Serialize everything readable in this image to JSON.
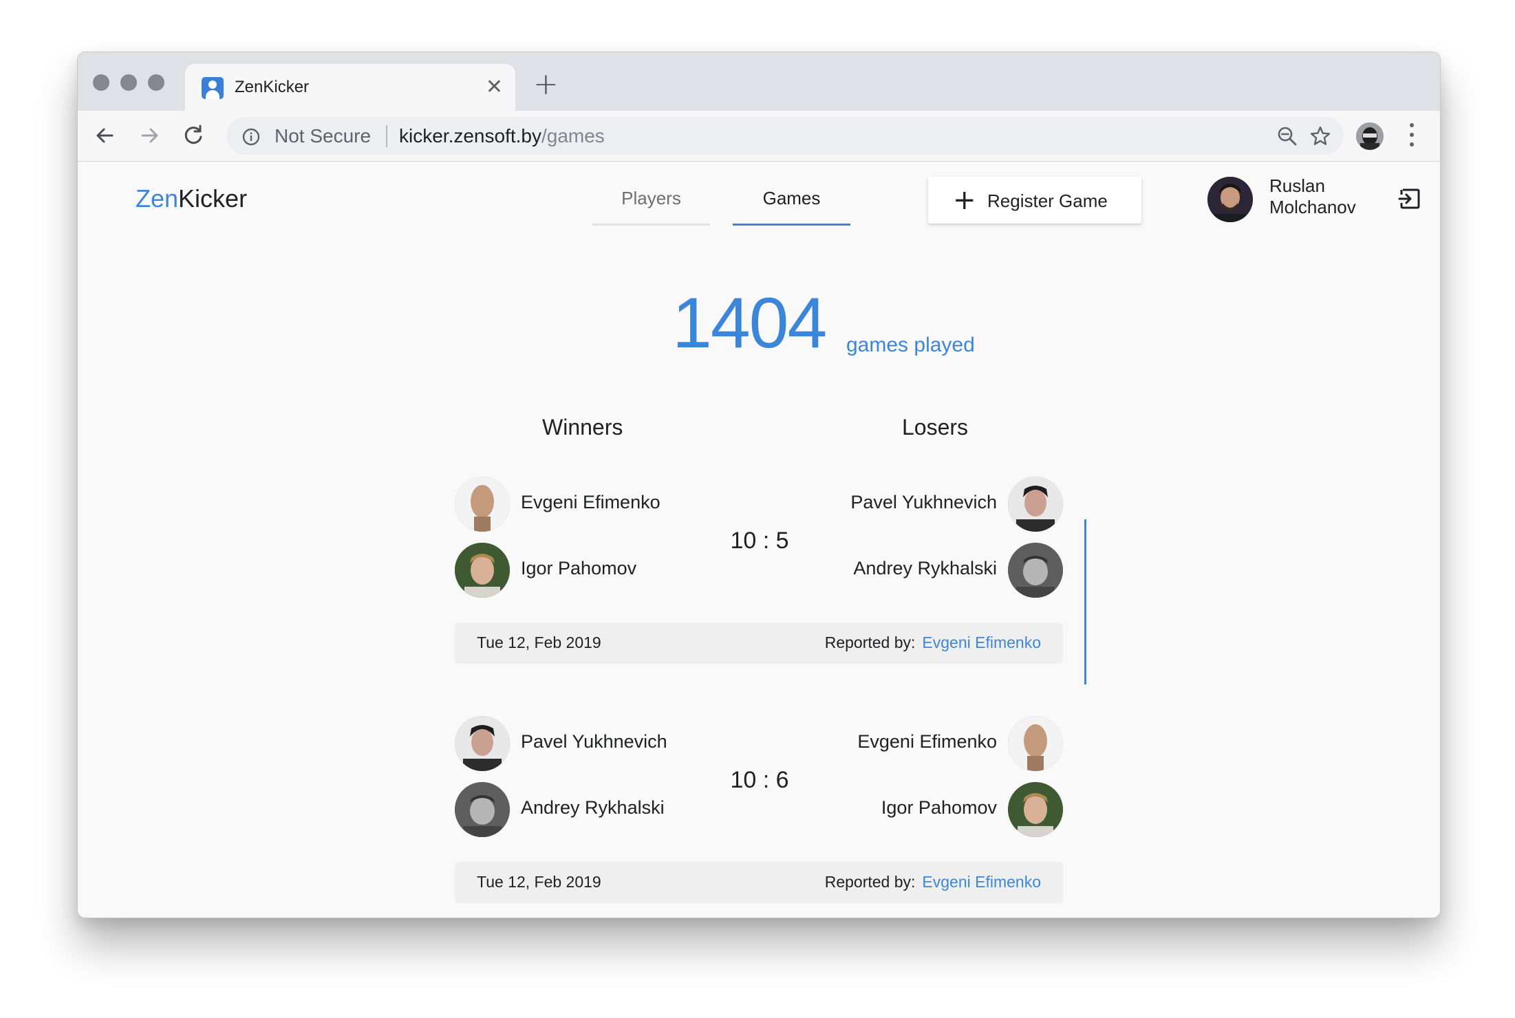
{
  "browser": {
    "tab_title": "ZenKicker",
    "url_security": "Not Secure",
    "url_host": "kicker.zensoft.by",
    "url_path": "/games"
  },
  "header": {
    "logo_prefix": "Zen",
    "logo_suffix": "Kicker",
    "nav": [
      {
        "label": "Players",
        "active": false
      },
      {
        "label": "Games",
        "active": true
      }
    ],
    "register_label": "Register Game",
    "user_first": "Ruslan",
    "user_last": "Molchanov"
  },
  "stats": {
    "games_count": "1404",
    "games_label": "games played"
  },
  "columns": {
    "winners": "Winners",
    "losers": "Losers"
  },
  "games": [
    {
      "winners": [
        "Evgeni Efimenko",
        "Igor Pahomov"
      ],
      "losers": [
        "Pavel Yukhnevich",
        "Andrey Rykhalski"
      ],
      "score": "10 : 5",
      "date": "Tue 12, Feb 2019",
      "reported_label": "Reported by:",
      "reported_by": "Evgeni Efimenko"
    },
    {
      "winners": [
        "Pavel Yukhnevich",
        "Andrey Rykhalski"
      ],
      "losers": [
        "Evgeni Efimenko",
        "Igor Pahomov"
      ],
      "score": "10 : 6",
      "date": "Tue 12, Feb 2019",
      "reported_label": "Reported by:",
      "reported_by": "Evgeni Efimenko"
    }
  ],
  "colors": {
    "accent": "#3b86d8",
    "text": "#202124",
    "muted": "#80868b"
  }
}
